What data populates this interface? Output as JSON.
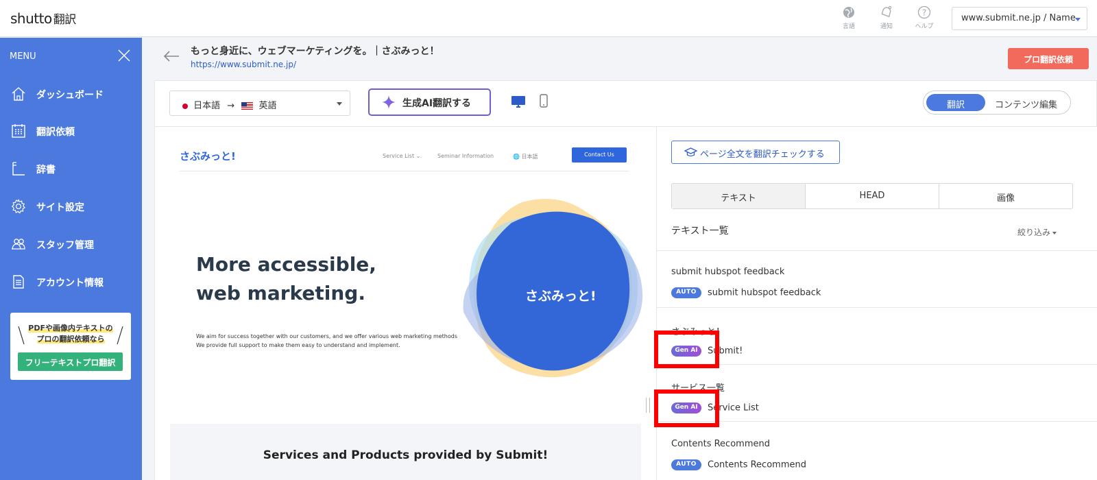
{
  "topbar": {
    "logo_main": "shutto",
    "logo_sub": "翻訳",
    "icons": [
      {
        "name": "globe-icon",
        "caption": "言語"
      },
      {
        "name": "bell-icon",
        "caption": "通知"
      },
      {
        "name": "help-icon",
        "caption": "ヘルプ"
      }
    ],
    "site_selector": "www.submit.ne.jp / Name"
  },
  "sidebar": {
    "menu_label": "MENU",
    "items": [
      {
        "icon": "home-icon",
        "label": "ダッシュボード"
      },
      {
        "icon": "calendar-icon",
        "label": "翻訳依頼"
      },
      {
        "icon": "book-icon",
        "label": "辞書"
      },
      {
        "icon": "gear-icon",
        "label": "サイト設定"
      },
      {
        "icon": "staff-icon",
        "label": "スタッフ管理"
      },
      {
        "icon": "document-icon",
        "label": "アカウント情報"
      }
    ],
    "promo": {
      "line1": "PDFや画像内テキストの",
      "line2": "プロの翻訳依頼なら",
      "button": "フリーテキストプロ翻訳"
    }
  },
  "header": {
    "title": "もっと身近に、ウェブマーケティングを。｜さぶみっと！",
    "url": "https://www.submit.ne.jp/",
    "pro_button": "プロ翻訳依頼"
  },
  "toolbar": {
    "source_lang": "日本語",
    "arrow": "→",
    "target_lang": "英語",
    "ai_button": "生成AI翻訳する",
    "mode_translate": "翻訳",
    "mode_content": "コンテンツ編集",
    "active_mode": "翻訳"
  },
  "preview": {
    "logo": "さぶみっと!",
    "nav": [
      "Service List ⌄",
      "Seminar Information",
      "🌐 日本語"
    ],
    "contact": "Contact Us",
    "headline1": "More accessible,",
    "headline2": "web marketing.",
    "para1": "We aim for success together with our customers, and we offer various web marketing methods",
    "para2": "We provide full support to make them easy to understand and implement.",
    "blob_text": "さぶみっと!",
    "section_title": "Services and Products provided by Submit!"
  },
  "panel": {
    "check_button": "ページ全文を翻訳チェックする",
    "tabs": [
      "テキスト",
      "HEAD",
      "画像"
    ],
    "active_tab": "テキスト",
    "list_title": "テキスト一覧",
    "filter": "絞り込み",
    "rows": [
      {
        "source": "submit hubspot feedback",
        "badge": "AUTO",
        "translation": "submit hubspot feedback"
      },
      {
        "source": "さぶみっと！",
        "badge": "Gen AI",
        "translation": "Submit!"
      },
      {
        "source": "サービス一覧",
        "badge": "Gen AI",
        "translation": "Service List"
      },
      {
        "source": "Contents Recommend",
        "badge": "AUTO",
        "translation": "Contents Recommend"
      }
    ]
  },
  "colors": {
    "sidebar": "#4b79de",
    "accent": "#4b79de",
    "pro_button": "#f26a5c",
    "promo_button": "#33b37b",
    "highlight": "#ff0000"
  }
}
